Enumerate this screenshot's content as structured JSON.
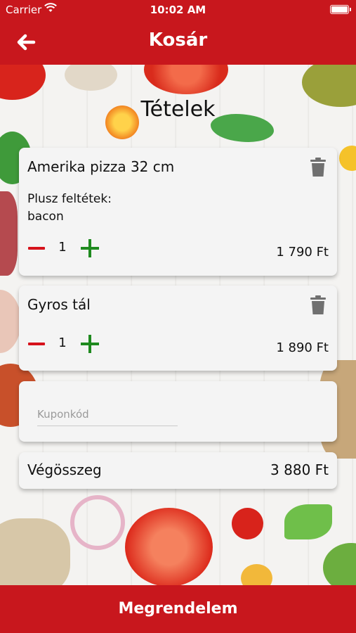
{
  "status_bar": {
    "carrier": "Carrier",
    "time": "10:02 AM"
  },
  "header": {
    "title": "Kosár",
    "back_icon": "arrow-left-icon"
  },
  "section_title": "Tételek",
  "cart_items": [
    {
      "name": "Amerika pizza 32 cm",
      "extras_label": "Plusz feltétek:",
      "extras_value": "bacon",
      "quantity": "1",
      "price": "1 790 Ft"
    },
    {
      "name": "Gyros tál",
      "quantity": "1",
      "price": "1 890 Ft"
    }
  ],
  "coupon": {
    "placeholder": "Kuponkód",
    "value": ""
  },
  "total": {
    "label": "Végösszeg",
    "value": "3 880 Ft"
  },
  "order_button": {
    "label": "Megrendelem"
  },
  "colors": {
    "brand_red": "#c8171d",
    "minus_red": "#d6121b",
    "plus_green": "#1f8a1f"
  }
}
